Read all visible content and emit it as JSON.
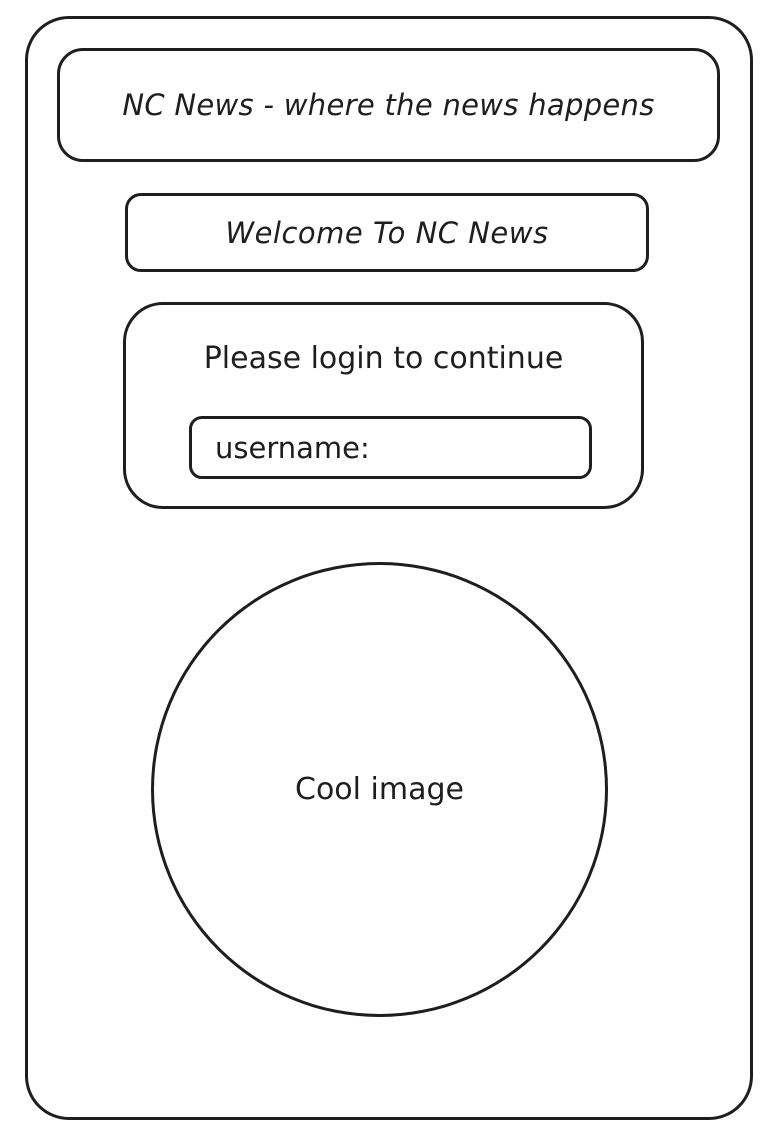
{
  "header": {
    "title": "NC News - where the news happens"
  },
  "welcome": {
    "text": "Welcome To NC News"
  },
  "login": {
    "prompt": "Please login to continue",
    "username_label": "username:"
  },
  "image": {
    "label": "Cool image"
  }
}
